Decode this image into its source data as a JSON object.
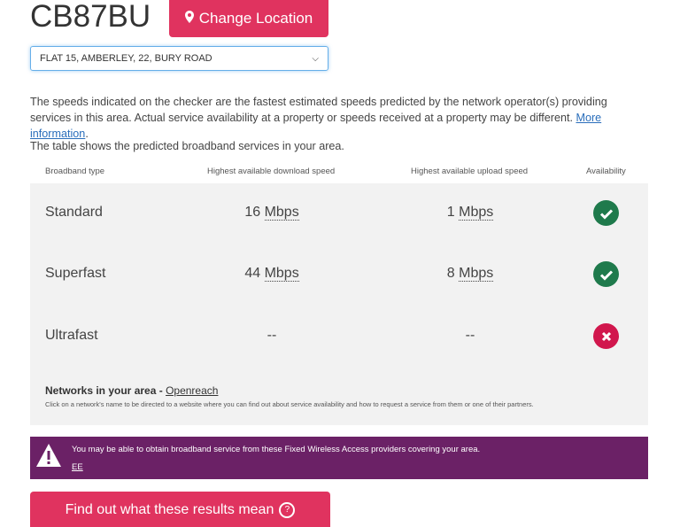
{
  "header": {
    "postcode": "CB87BU",
    "change_location_label": "Change Location"
  },
  "address_select": {
    "selected": "FLAT 15, AMBERLEY, 22, BURY ROAD"
  },
  "intro": {
    "text": "The speeds indicated on the checker are the fastest estimated speeds predicted by the network operator(s) providing services in this area. Actual service availability at a property or speeds received at a property may be different.",
    "link_text": "More information",
    "trailing": ".",
    "table_intro": "The table shows the predicted broadband services in your area."
  },
  "table": {
    "headers": {
      "type": "Broadband type",
      "download": "Highest available download speed",
      "upload": "Highest available upload speed",
      "availability": "Availability"
    },
    "rows": [
      {
        "type": "Standard",
        "download_value": "16",
        "download_unit": "Mbps",
        "upload_value": "1",
        "upload_unit": "Mbps",
        "available": true,
        "icon": "check-circle-icon"
      },
      {
        "type": "Superfast",
        "download_value": "44",
        "download_unit": "Mbps",
        "upload_value": "8",
        "upload_unit": "Mbps",
        "available": true,
        "icon": "check-circle-icon"
      },
      {
        "type": "Ultrafast",
        "download_value": "--",
        "download_unit": "",
        "upload_value": "--",
        "upload_unit": "",
        "available": false,
        "icon": "cross-circle-icon"
      }
    ]
  },
  "networks": {
    "label": "Networks in your area -",
    "link": "Openreach",
    "note": "Click on a network's name to be directed to a website where you can find out about service availability and how to request a service from them or one of their partners."
  },
  "wireless_notice": {
    "message": "You may be able to obtain broadband service from these Fixed Wireless Access providers covering your area.",
    "provider": "EE",
    "icon": "warning-icon"
  },
  "results_button": {
    "label": "Find out what these results mean"
  },
  "colors": {
    "accent": "#e0335f",
    "available": "#1f7a4c",
    "unavailable": "#d1174d",
    "notice_bg": "#6b2166",
    "link": "#2a6ebb"
  }
}
